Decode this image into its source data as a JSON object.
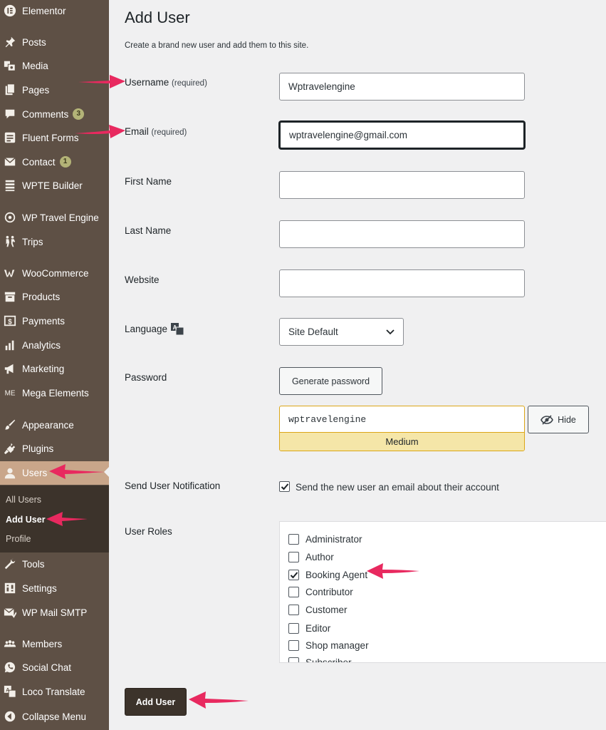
{
  "sidebar": {
    "items": [
      {
        "label": "Elementor",
        "icon": "elementor-icon"
      },
      {
        "label": "Posts",
        "icon": "pin-icon"
      },
      {
        "label": "Media",
        "icon": "media-icon"
      },
      {
        "label": "Pages",
        "icon": "pages-icon"
      },
      {
        "label": "Comments",
        "icon": "comments-icon",
        "badge": "3"
      },
      {
        "label": "Fluent Forms",
        "icon": "forms-icon"
      },
      {
        "label": "Contact",
        "icon": "mail-icon",
        "badge": "1"
      },
      {
        "label": "WPTE Builder",
        "icon": "builder-icon"
      },
      {
        "label": "WP Travel Engine",
        "icon": "travel-icon"
      },
      {
        "label": "Trips",
        "icon": "hikers-icon"
      },
      {
        "label": "WooCommerce",
        "icon": "woo-icon"
      },
      {
        "label": "Products",
        "icon": "archive-icon"
      },
      {
        "label": "Payments",
        "icon": "dollar-icon"
      },
      {
        "label": "Analytics",
        "icon": "chart-icon"
      },
      {
        "label": "Marketing",
        "icon": "megaphone-icon"
      },
      {
        "label": "Mega Elements",
        "icon": "me-icon"
      },
      {
        "label": "Appearance",
        "icon": "brush-icon"
      },
      {
        "label": "Plugins",
        "icon": "plug-icon"
      },
      {
        "label": "Users",
        "icon": "user-icon"
      },
      {
        "label": "Tools",
        "icon": "wrench-icon"
      },
      {
        "label": "Settings",
        "icon": "settings-icon"
      },
      {
        "label": "WP Mail SMTP",
        "icon": "mail-smtp-icon"
      },
      {
        "label": "Members",
        "icon": "members-icon"
      },
      {
        "label": "Social Chat",
        "icon": "whatsapp-icon"
      },
      {
        "label": "Loco Translate",
        "icon": "translate-icon"
      },
      {
        "label": "Collapse Menu",
        "icon": "collapse-icon"
      }
    ],
    "submenu": {
      "all_users": "All Users",
      "add_user": "Add User",
      "profile": "Profile"
    }
  },
  "page": {
    "title": "Add User",
    "intro": "Create a brand new user and add them to this site."
  },
  "form": {
    "username": {
      "label": "Username",
      "req": "(required)",
      "value": "Wptravelengine"
    },
    "email": {
      "label": "Email",
      "req": "(required)",
      "value": "wptravelengine@gmail.com"
    },
    "first_name": {
      "label": "First Name",
      "value": ""
    },
    "last_name": {
      "label": "Last Name",
      "value": ""
    },
    "website": {
      "label": "Website",
      "value": ""
    },
    "language": {
      "label": "Language",
      "value": "Site Default"
    },
    "password": {
      "label": "Password",
      "generate_label": "Generate password",
      "value": "wptravelengine",
      "strength": "Medium",
      "hide_label": "Hide"
    },
    "notification": {
      "label": "Send User Notification",
      "text": "Send the new user an email about their account",
      "checked": true
    },
    "roles": {
      "label": "User Roles",
      "options": [
        {
          "name": "Administrator",
          "checked": false
        },
        {
          "name": "Author",
          "checked": false
        },
        {
          "name": "Booking Agent",
          "checked": true
        },
        {
          "name": "Contributor",
          "checked": false
        },
        {
          "name": "Customer",
          "checked": false
        },
        {
          "name": "Editor",
          "checked": false
        },
        {
          "name": "Shop manager",
          "checked": false
        },
        {
          "name": "Subscriber",
          "checked": false
        }
      ]
    },
    "submit_label": "Add User"
  },
  "colors": {
    "sidebar_bg": "#5e5045",
    "sidebar_active": "#c9a68a",
    "annotation_arrow": "#e8295f",
    "strength_bg": "#f5e6a8"
  }
}
